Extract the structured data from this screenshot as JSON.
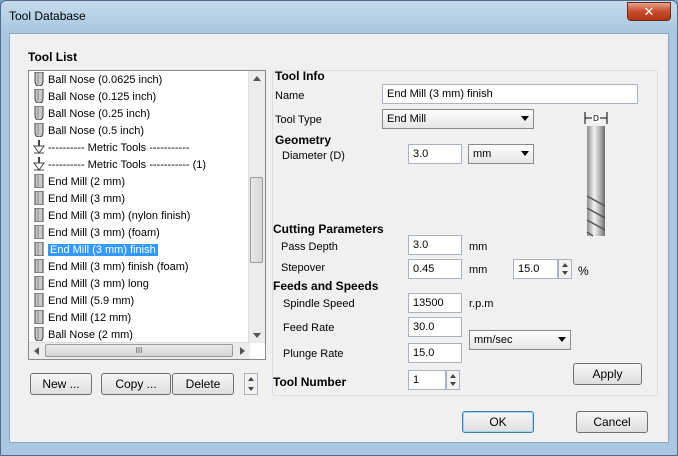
{
  "window": {
    "title": "Tool Database",
    "close_glyph": "✕"
  },
  "tool_list": {
    "heading": "Tool List",
    "items": [
      {
        "label": "Ball Nose (0.0625 inch)",
        "icon": "ball-nose-icon"
      },
      {
        "label": "Ball Nose (0.125 inch)",
        "icon": "ball-nose-icon"
      },
      {
        "label": "Ball Nose (0.25 inch)",
        "icon": "ball-nose-icon"
      },
      {
        "label": "Ball Nose (0.5 inch)",
        "icon": "ball-nose-icon"
      },
      {
        "label": "---------- Metric Tools -----------",
        "icon": "separator-arrow-icon"
      },
      {
        "label": "---------- Metric Tools ----------- (1)",
        "icon": "separator-arrow-icon"
      },
      {
        "label": "End Mill (2 mm)",
        "icon": "end-mill-icon"
      },
      {
        "label": "End Mill (3 mm)",
        "icon": "end-mill-icon"
      },
      {
        "label": "End Mill (3 mm) (nylon finish)",
        "icon": "end-mill-icon"
      },
      {
        "label": "End Mill (3 mm) (foam)",
        "icon": "end-mill-icon"
      },
      {
        "label": "End Mill (3 mm) finish",
        "icon": "end-mill-icon",
        "selected": true
      },
      {
        "label": "End Mill (3 mm) finish (foam)",
        "icon": "end-mill-icon"
      },
      {
        "label": "End Mill (3 mm) long",
        "icon": "end-mill-icon"
      },
      {
        "label": "End Mill (5.9 mm)",
        "icon": "end-mill-icon"
      },
      {
        "label": "End Mill (12 mm)",
        "icon": "end-mill-icon"
      },
      {
        "label": "Ball Nose (2 mm)",
        "icon": "ball-nose-icon"
      }
    ],
    "hscroll_grip": "III",
    "buttons": {
      "new": "New ...",
      "copy": "Copy ...",
      "delete": "Delete"
    }
  },
  "tool_info": {
    "heading": "Tool Info",
    "name_label": "Name",
    "name_value": "End Mill (3 mm) finish",
    "type_label": "Tool Type",
    "type_value": "End Mill",
    "diagram_label": "D"
  },
  "geometry": {
    "heading": "Geometry",
    "diameter_label": "Diameter (D)",
    "diameter_value": "3.0",
    "diameter_unit": "mm"
  },
  "cutting": {
    "heading": "Cutting Parameters",
    "pass_depth_label": "Pass Depth",
    "pass_depth_value": "3.0",
    "pass_depth_unit": "mm",
    "stepover_label": "Stepover",
    "stepover_value": "0.45",
    "stepover_unit": "mm",
    "stepover_percent": "15.0",
    "percent_sign": "%"
  },
  "feeds": {
    "heading": "Feeds and Speeds",
    "spindle_label": "Spindle Speed",
    "spindle_value": "13500",
    "spindle_unit": "r.p.m",
    "feed_label": "Feed Rate",
    "feed_value": "30.0",
    "plunge_label": "Plunge Rate",
    "plunge_value": "15.0",
    "rate_unit": "mm/sec"
  },
  "tool_number": {
    "label": "Tool Number",
    "value": "1"
  },
  "buttons": {
    "apply": "Apply",
    "ok": "OK",
    "cancel": "Cancel"
  }
}
